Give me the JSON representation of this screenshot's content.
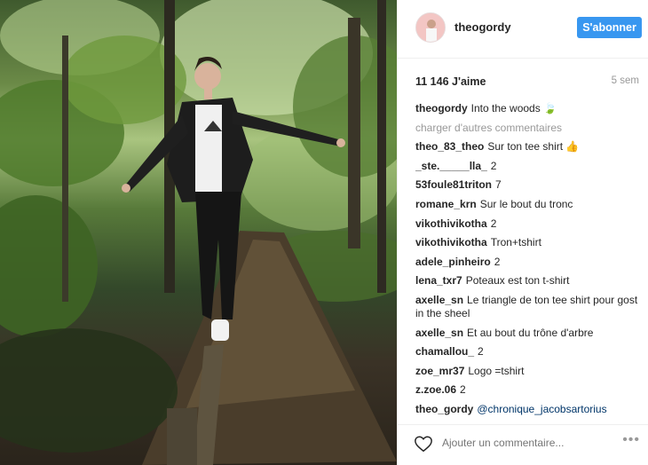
{
  "post": {
    "username": "theogordy",
    "follow_label": "S'abonner",
    "likes_text": "11 146 J'aime",
    "age_text": "5 sem",
    "caption": {
      "user": "theogordy",
      "text": "Into the woods 🍃"
    },
    "load_more_label": "charger d'autres commentaires",
    "comments": [
      {
        "user": "theo_83_theo",
        "text": "Sur ton tee shirt 👍"
      },
      {
        "user": "_ste._____lla_",
        "text": "2"
      },
      {
        "user": "53foule81triton",
        "text": "7"
      },
      {
        "user": "romane_krn",
        "text": "Sur le bout du tronc"
      },
      {
        "user": "vikothivikotha",
        "text": "2"
      },
      {
        "user": "vikothivikotha",
        "text": "Tron+tshirt"
      },
      {
        "user": "adele_pinheiro",
        "text": "2"
      },
      {
        "user": "lena_txr7",
        "text": "Poteaux est ton t-shirt"
      },
      {
        "user": "axelle_sn",
        "text": "Le triangle de ton tee shirt pour gost in the sheel"
      },
      {
        "user": "axelle_sn",
        "text": "Et au bout du trône d'arbre"
      },
      {
        "user": "chamallou_",
        "text": "2"
      },
      {
        "user": "zoe_mr37",
        "text": "Logo =tshirt"
      },
      {
        "user": "z.zoe.06",
        "text": "2"
      },
      {
        "user": "theo_gordy",
        "text": "@chronique_jacobsartorius",
        "mention": true
      }
    ],
    "comment_placeholder": "Ajouter un commentaire...",
    "more_label": "•••"
  },
  "colors": {
    "accent": "#3897f0",
    "muted": "#999999",
    "text": "#262626"
  },
  "icons": {
    "like": "heart-icon",
    "options": "more-options-icon"
  }
}
